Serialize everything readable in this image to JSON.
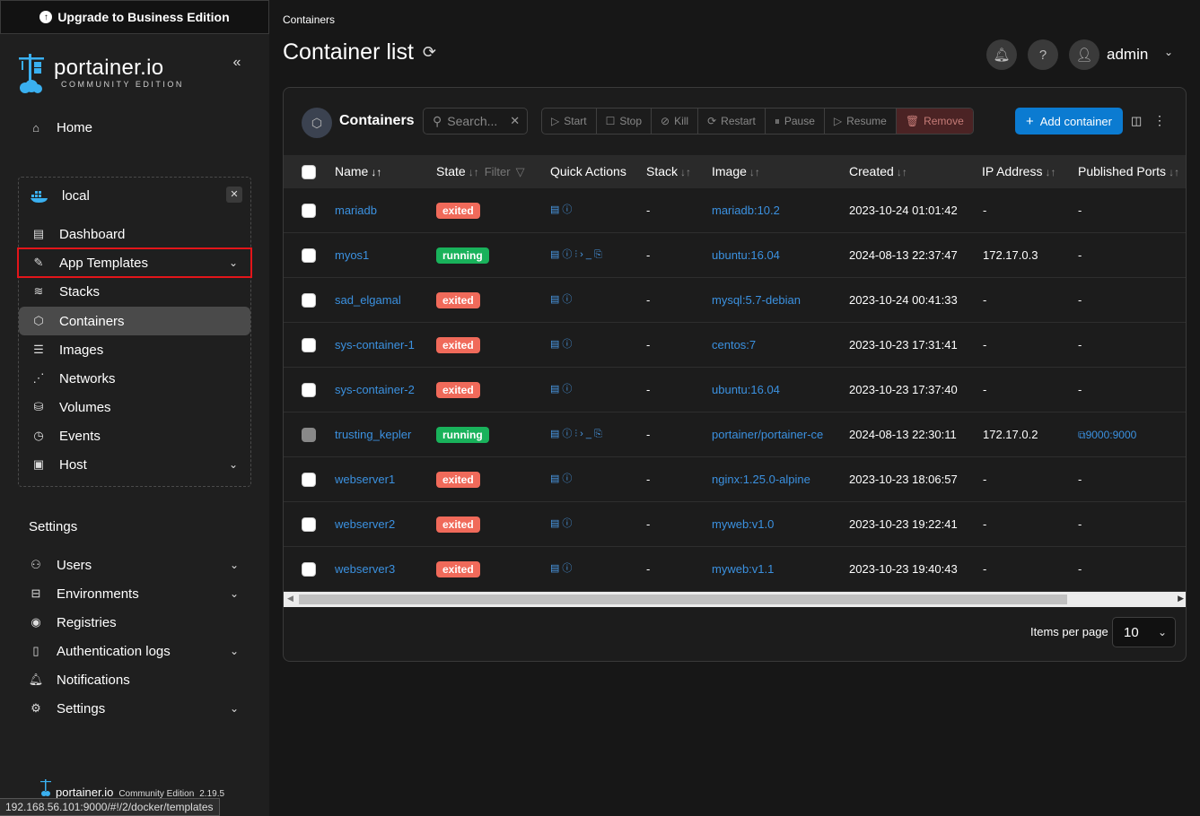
{
  "sidebar": {
    "upgrade_label": "Upgrade to Business Edition",
    "logo_text": "portainer.io",
    "logo_subtext": "COMMUNITY EDITION",
    "home_label": "Home",
    "environment": {
      "name": "local",
      "items": [
        {
          "label": "Dashboard",
          "icon": "dashboard-icon"
        },
        {
          "label": "App Templates",
          "icon": "edit-icon",
          "expandable": true,
          "highlighted": true
        },
        {
          "label": "Stacks",
          "icon": "layers-icon"
        },
        {
          "label": "Containers",
          "icon": "cube-icon",
          "active": true
        },
        {
          "label": "Images",
          "icon": "list-icon"
        },
        {
          "label": "Networks",
          "icon": "share-icon"
        },
        {
          "label": "Volumes",
          "icon": "database-icon"
        },
        {
          "label": "Events",
          "icon": "clock-icon"
        },
        {
          "label": "Host",
          "icon": "server-icon",
          "expandable": true
        }
      ]
    },
    "settings_heading": "Settings",
    "settings_items": [
      {
        "label": "Users",
        "icon": "users-icon",
        "expandable": true
      },
      {
        "label": "Environments",
        "icon": "environments-icon",
        "expandable": true
      },
      {
        "label": "Registries",
        "icon": "radio-icon",
        "expandable": false
      },
      {
        "label": "Authentication logs",
        "icon": "file-icon",
        "expandable": true
      },
      {
        "label": "Notifications",
        "icon": "bell-icon",
        "expandable": false
      },
      {
        "label": "Settings",
        "icon": "gear-icon",
        "expandable": true
      }
    ],
    "footer": {
      "brand": "portainer.io",
      "edition": "Community Edition",
      "version": "2.19.5"
    },
    "status_url": "192.168.56.101:9000/#!/2/docker/templates"
  },
  "header": {
    "breadcrumb": "Containers",
    "title": "Container list",
    "user": "admin"
  },
  "panel": {
    "title": "Containers",
    "search_placeholder": "Search...",
    "actions": {
      "start": "Start",
      "stop": "Stop",
      "kill": "Kill",
      "restart": "Restart",
      "pause": "Pause",
      "resume": "Resume",
      "remove": "Remove"
    },
    "add_label": "Add container",
    "columns": {
      "name": "Name",
      "state": "State",
      "filter": "Filter",
      "quick_actions": "Quick Actions",
      "stack": "Stack",
      "image": "Image",
      "created": "Created",
      "ip": "IP Address",
      "ports": "Published Ports"
    },
    "rows": [
      {
        "name": "mariadb",
        "state": "exited",
        "stack": "-",
        "image": "mariadb:10.2",
        "created": "2023-10-24 01:01:42",
        "ip": "-",
        "ports": "-"
      },
      {
        "name": "myos1",
        "state": "running",
        "stack": "-",
        "image": "ubuntu:16.04",
        "created": "2024-08-13 22:37:47",
        "ip": "172.17.0.3",
        "ports": "-"
      },
      {
        "name": "sad_elgamal",
        "state": "exited",
        "stack": "-",
        "image": "mysql:5.7-debian",
        "created": "2023-10-24 00:41:33",
        "ip": "-",
        "ports": "-"
      },
      {
        "name": "sys-container-1",
        "state": "exited",
        "stack": "-",
        "image": "centos:7",
        "created": "2023-10-23 17:31:41",
        "ip": "-",
        "ports": "-"
      },
      {
        "name": "sys-container-2",
        "state": "exited",
        "stack": "-",
        "image": "ubuntu:16.04",
        "created": "2023-10-23 17:37:40",
        "ip": "-",
        "ports": "-"
      },
      {
        "name": "trusting_kepler",
        "state": "running",
        "stack": "-",
        "image": "portainer/portainer-ce",
        "created": "2024-08-13 22:30:11",
        "ip": "172.17.0.2",
        "ports": "9000:9000"
      },
      {
        "name": "webserver1",
        "state": "exited",
        "stack": "-",
        "image": "nginx:1.25.0-alpine",
        "created": "2023-10-23 18:06:57",
        "ip": "-",
        "ports": "-"
      },
      {
        "name": "webserver2",
        "state": "exited",
        "stack": "-",
        "image": "myweb:v1.0",
        "created": "2023-10-23 19:22:41",
        "ip": "-",
        "ports": "-"
      },
      {
        "name": "webserver3",
        "state": "exited",
        "stack": "-",
        "image": "myweb:v1.1",
        "created": "2023-10-23 19:40:43",
        "ip": "-",
        "ports": "-"
      }
    ],
    "items_per_page_label": "Items per page",
    "items_per_page_value": "10"
  },
  "colors": {
    "accent": "#0b7bd1",
    "link": "#3b91e0",
    "exited": "#f06a5a",
    "running": "#19b25b",
    "highlight_border": "#e3151a"
  }
}
